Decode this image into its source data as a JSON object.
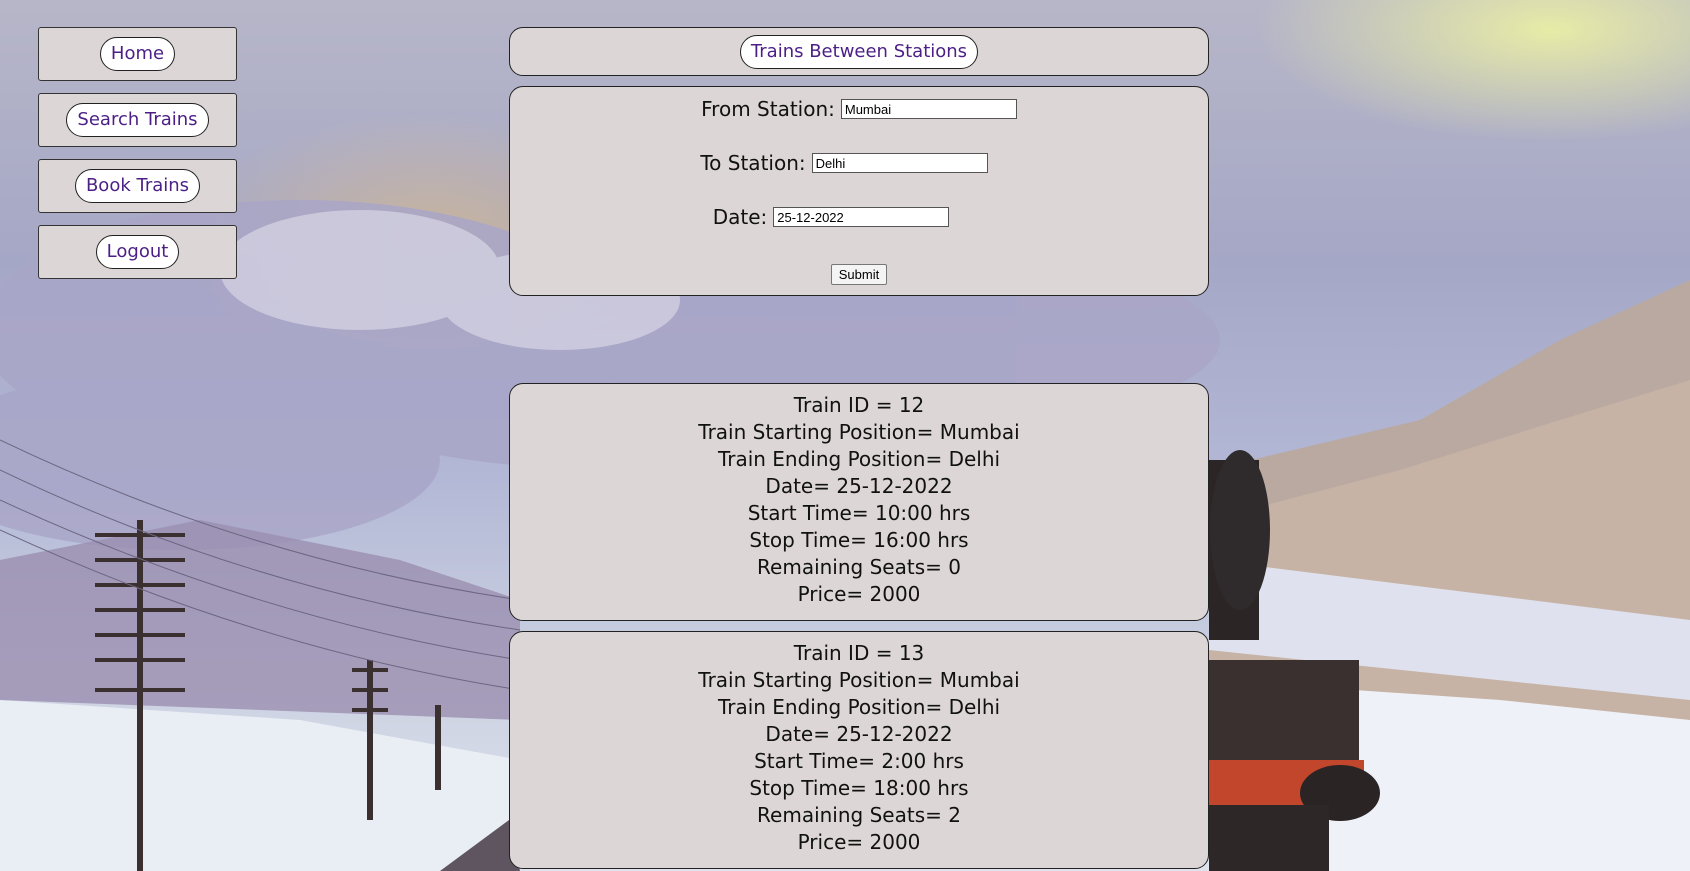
{
  "nav": {
    "home": "Home",
    "search": "Search Trains",
    "book": "Book Trains",
    "logout": "Logout"
  },
  "header": {
    "title": "Trains Between Stations"
  },
  "form": {
    "from_label": "From Station:",
    "from_value": "Mumbai",
    "to_label": "To Station:",
    "to_value": "Delhi",
    "date_label": "Date:",
    "date_value": "25-12-2022",
    "submit": "Submit"
  },
  "trains": [
    {
      "id": "Train ID = 12",
      "start": "Train Starting Position= Mumbai",
      "end": "Train Ending Position= Delhi",
      "date": "Date= 25-12-2022",
      "start_time": "Start Time= 10:00 hrs",
      "stop_time": "Stop Time= 16:00 hrs",
      "seats": "Remaining Seats= 0",
      "price": "Price= 2000"
    },
    {
      "id": "Train ID = 13",
      "start": "Train Starting Position= Mumbai",
      "end": "Train Ending Position= Delhi",
      "date": "Date= 25-12-2022",
      "start_time": "Start Time= 2:00 hrs",
      "stop_time": "Stop Time= 18:00 hrs",
      "seats": "Remaining Seats= 2",
      "price": "Price= 2000"
    }
  ]
}
